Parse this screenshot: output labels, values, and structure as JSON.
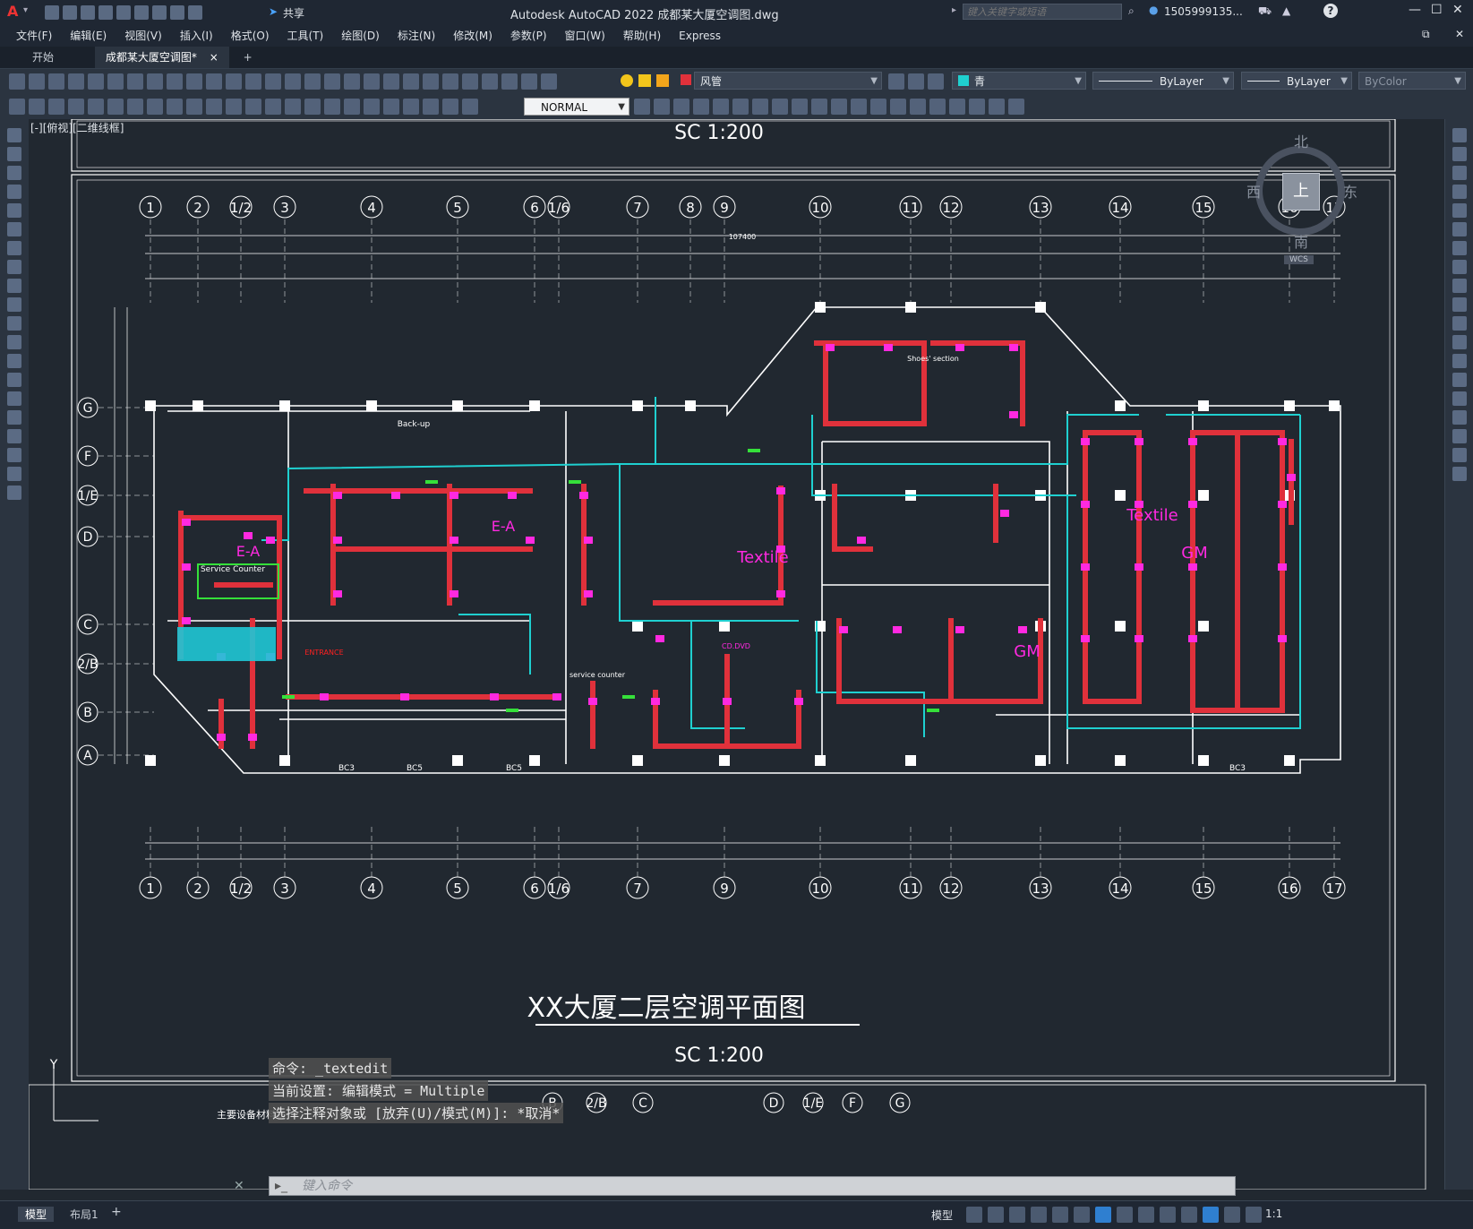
{
  "app": {
    "title": "Autodesk AutoCAD 2022    成都某大厦空调图.dwg",
    "logo": "A",
    "share_label": "共享",
    "search_placeholder": "键入关键字或短语",
    "user": "1505999135...",
    "help": "?"
  },
  "menu": [
    "文件(F)",
    "编辑(E)",
    "视图(V)",
    "插入(I)",
    "格式(O)",
    "工具(T)",
    "绘图(D)",
    "标注(N)",
    "修改(M)",
    "参数(P)",
    "窗口(W)",
    "帮助(H)",
    "Express"
  ],
  "file_tabs": [
    {
      "label": "开始",
      "active": false
    },
    {
      "label": "成都某大厦空调图*",
      "active": true,
      "close": "×"
    }
  ],
  "new_tab": "+",
  "toolbar": {
    "layer_name": "风管",
    "color_name": "青",
    "linetype": "ByLayer",
    "lineweight": "ByLayer",
    "plotstyle": "ByColor",
    "dimstyle": "NORMAL"
  },
  "viewport": {
    "label": "[-][俯视][二维线框]",
    "title_main": "XX大厦二层空调平面图",
    "scale_top": "SC    1:200",
    "scale_bottom": "SC    1:200",
    "compass": {
      "n": "北",
      "s": "南",
      "w": "西",
      "e": "东",
      "center": "上",
      "wcs": "WCS"
    },
    "axis_y": "Y",
    "grid_top": [
      "1",
      "2",
      "1/2",
      "3",
      "4",
      "5",
      "6",
      "1/6",
      "7",
      "8",
      "9",
      "10",
      "11",
      "12",
      "13",
      "14",
      "15",
      "16",
      "17"
    ],
    "grid_bottom": [
      "1",
      "2",
      "1/2",
      "3",
      "4",
      "5",
      "6",
      "1/6",
      "7",
      "9",
      "10",
      "11",
      "12",
      "13",
      "14",
      "15",
      "16",
      "17"
    ],
    "grid_left": [
      "G",
      "F",
      "1/E",
      "D",
      "C",
      "2/B",
      "B",
      "A"
    ],
    "grid_bottom_row": [
      "B",
      "2/B",
      "C",
      "D",
      "1/E",
      "F",
      "G"
    ],
    "zone_labels": [
      "E-A",
      "E-A",
      "Textile",
      "Textile",
      "GM",
      "GM",
      "Shoes' section",
      "Back-up",
      "Service Counter",
      "ENTRANCE",
      "service counter",
      "CD.DVD"
    ],
    "bottom_notes": [
      "BC3",
      "BC5",
      "BC5",
      "BC3"
    ],
    "table_label": "主要设备材料表",
    "dim_total": "107400"
  },
  "command": {
    "lines": [
      "命令: _textedit",
      "当前设置: 编辑模式 = Multiple",
      "选择注释对象或 [放弃(U)/模式(M)]: *取消*"
    ],
    "input_placeholder": "键入命令"
  },
  "layout_tabs": [
    "模型",
    "布局1"
  ],
  "status": {
    "model": "模型",
    "scale": "1:1"
  },
  "colors": {
    "duct_red": "#e0313b",
    "pipe_cyan": "#1fd0d0",
    "unit_magenta": "#ff29e0",
    "linework": "#ffffff",
    "green": "#35e03a"
  }
}
